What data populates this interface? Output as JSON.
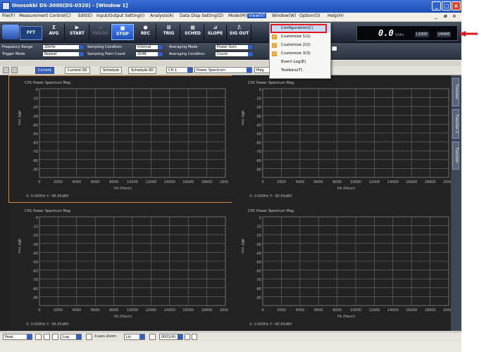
{
  "window": {
    "title": "Onosokki DS-3000(DS-0320) - [Window 1]",
    "controls": [
      "_",
      "□",
      "×"
    ]
  },
  "menu": {
    "items": [
      "File(F)",
      "Measurement Control(C)",
      "Edit(E)",
      "Input/Output Setting(I)",
      "Analysis(A)",
      "Data Disp Setting(D)",
      "Mode(M)",
      "View(V)",
      "Window(W)",
      "Option(O)",
      "Help(H)"
    ],
    "active": "View(V)",
    "mdi_controls": [
      "_",
      "ø",
      "×"
    ]
  },
  "toolbar": {
    "fft_label": "FFT",
    "buttons": [
      {
        "label": "AVG",
        "glyph": "Σ"
      },
      {
        "label": "START",
        "glyph": "▶"
      },
      {
        "label": "PAUSE",
        "glyph": "⏸"
      },
      {
        "label": "STOP",
        "glyph": "■"
      },
      {
        "label": "REC",
        "glyph": "●"
      },
      {
        "label": "TRIG",
        "glyph": "⊞"
      },
      {
        "label": "SCHED",
        "glyph": "▦"
      },
      {
        "label": "SLOPE",
        "glyph": "⊿"
      },
      {
        "label": "SIG OUT",
        "glyph": "⎍"
      }
    ],
    "display_value": "0.0",
    "display_unit": "V/div",
    "frame_left": "L1000",
    "frame_right": "U4000"
  },
  "params": {
    "frequency_range": {
      "label": "Frequency Range",
      "value": "20kHz"
    },
    "trigger_mode": {
      "label": "Trigger Mode",
      "value": "Repeat"
    },
    "sampling_condition": {
      "label": "Sampling Condition",
      "value": "Internal"
    },
    "sampling_point_count": {
      "label": "Sampling Point Count",
      "value": "2048"
    },
    "averaging_mode": {
      "label": "Averaging Mode",
      "value": "Power Sum"
    },
    "averaging_condition": {
      "label": "Averaging Condition",
      "value": "Count"
    }
  },
  "view_tabs": {
    "tabs": [
      "Current",
      "Current-3D",
      "Schedule",
      "Schedule-3D"
    ],
    "active": "Current",
    "channel": "CH 1",
    "function": "Power Spectrum",
    "scale": "Mag"
  },
  "graph": {
    "title": "CH1 Power Spectrum Mag",
    "ylabel": "dBV rms",
    "xlabel": "Hz (Hann)",
    "cursor": "X: 0.000Hz  Y: -95.65dBV",
    "yticks": [
      "0",
      "-10",
      "-20",
      "-30",
      "-40",
      "-50",
      "-60",
      "-70",
      "-80",
      "-90"
    ],
    "xticks": [
      "0",
      "2000",
      "4000",
      "6000",
      "8000",
      "10000",
      "12000",
      "14000",
      "16000",
      "18000",
      "20000"
    ]
  },
  "side_tabs": [
    "Function",
    "Function 2",
    "Function"
  ],
  "statusbar": {
    "peak": "Peak",
    "axis": "Log",
    "xaxis_zoom_label": "X-axis Zoom",
    "xaxis_zoom_value": "Lin",
    "frame_value": "0001(H)"
  },
  "view_menu": {
    "items": [
      {
        "label": "Configuration(C)",
        "checked": false
      },
      {
        "label": "Customize 1(1)",
        "checked": true
      },
      {
        "label": "Customize 2(2)",
        "checked": true
      },
      {
        "label": "Customize 3(3)",
        "checked": true
      },
      {
        "label": "Event Log(E)",
        "checked": false
      },
      {
        "label": "Toolbars(T)",
        "checked": false
      }
    ],
    "highlighted": "Configuration(C)",
    "highlight_color": "#e0141a"
  },
  "colors": {
    "title_bar": "#2155c6",
    "plot_grid": "#6f6f6f",
    "plot_background": "#202020",
    "selected_graph_border": "#d88a3a",
    "annotation_arrow": "#e0141a"
  }
}
